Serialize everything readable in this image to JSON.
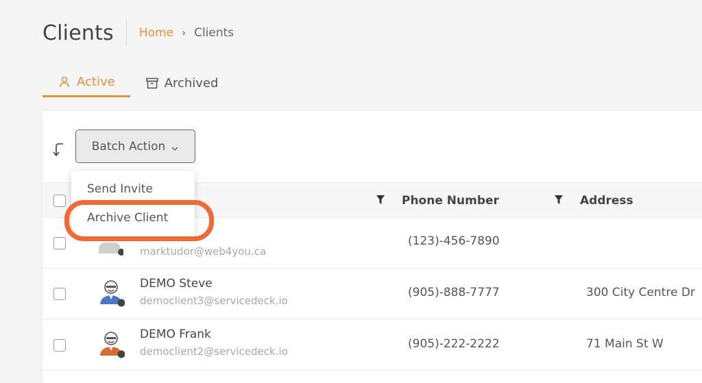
{
  "header": {
    "title": "Clients",
    "breadcrumb": {
      "home": "Home",
      "separator": "›",
      "current": "Clients"
    }
  },
  "tabs": [
    {
      "label": "Active",
      "icon": "user-icon",
      "active": true
    },
    {
      "label": "Archived",
      "icon": "archive-box-icon",
      "active": false
    }
  ],
  "toolbar": {
    "refresh_icon": "refresh-icon",
    "batch_action_label": "Batch Action"
  },
  "dropdown": {
    "items": [
      "Send Invite",
      "Archive Client"
    ],
    "highlighted": "Archive Client"
  },
  "table": {
    "columns": [
      "Phone Number",
      "Address"
    ],
    "rows": [
      {
        "name": "",
        "email": "marktudor@web4you.ca",
        "phone": "(123)-456-7890",
        "address": ""
      },
      {
        "name": "DEMO Steve",
        "email": "democlient3@servicedeck.io",
        "phone": "(905)-888-7777",
        "address": "300 City Centre Dr"
      },
      {
        "name": "DEMO Frank",
        "email": "democlient2@servicedeck.io",
        "phone": "(905)-222-2222",
        "address": "71 Main St W"
      }
    ]
  },
  "colors": {
    "accent": "#e8913a",
    "highlight": "#f26a32",
    "avatar_blue": "#4a78c9",
    "avatar_orange": "#d96b2c"
  }
}
